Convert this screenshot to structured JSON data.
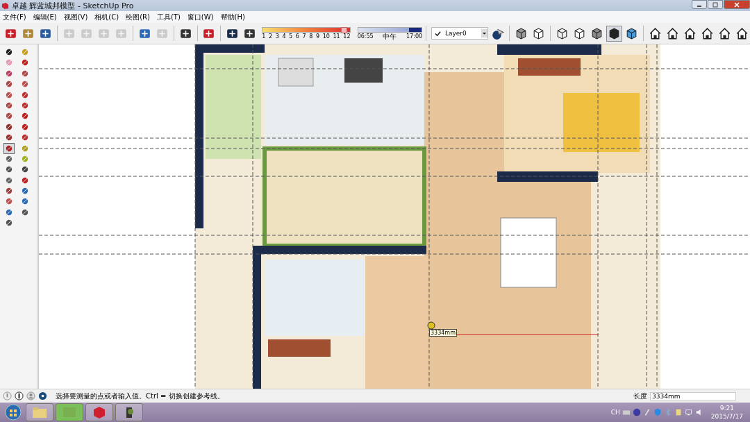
{
  "window": {
    "title": "卓越 辉蓝城邦模型 - SketchUp Pro"
  },
  "menu": [
    "文件(F)",
    "编辑(E)",
    "视图(V)",
    "相机(C)",
    "绘图(R)",
    "工具(T)",
    "窗口(W)",
    "帮助(H)"
  ],
  "toolbar": [
    {
      "disabled": false
    },
    {
      "disabled": false
    },
    {
      "disabled": false
    },
    {
      "disabled": true
    },
    {
      "disabled": true
    },
    {
      "disabled": true
    },
    {
      "disabled": true
    },
    {
      "disabled": false
    },
    {
      "disabled": true
    },
    {
      "disabled": false
    },
    {
      "disabled": false
    },
    {
      "disabled": false
    },
    {
      "disabled": false
    }
  ],
  "shadow_settings": {
    "date_slider": {
      "level": 0.93
    },
    "time_slider": {
      "level": 0.8
    },
    "months": [
      "1",
      "2",
      "3",
      "4",
      "5",
      "6",
      "7",
      "8",
      "9",
      "10",
      "11",
      "12"
    ],
    "time_start": "06:55",
    "time_middle": "中午",
    "time_end": "17:00"
  },
  "layer": {
    "value": "Layer0"
  },
  "view_tools": [
    {
      "selected": false
    },
    {
      "selected": false
    },
    {
      "selected": false
    },
    {
      "selected": false
    },
    {
      "selected": false
    },
    {
      "selected": true
    },
    {
      "selected": false
    }
  ],
  "camera_tools": [
    {
      "selected": false
    },
    {
      "selected": false
    },
    {
      "selected": false
    },
    {
      "selected": false
    },
    {
      "selected": false
    },
    {
      "selected": false
    }
  ],
  "left_tools": [
    {
      "selected": false
    },
    {
      "selected": false
    },
    {
      "selected": false
    },
    {
      "selected": false
    },
    {
      "selected": false
    },
    {
      "selected": false
    },
    {
      "selected": false
    },
    {
      "selected": false
    },
    {
      "selected": false
    },
    {
      "selected": false
    },
    {
      "selected": false
    },
    {
      "selected": false
    },
    {
      "selected": false
    },
    {
      "selected": false
    },
    {
      "selected": false
    },
    {
      "selected": false
    },
    {
      "selected": false
    },
    {
      "selected": false
    },
    {
      "selected": true
    },
    {
      "selected": false
    },
    {
      "selected": false
    },
    {
      "selected": false
    },
    {
      "selected": false
    },
    {
      "selected": false
    },
    {
      "selected": false
    },
    {
      "selected": false
    },
    {
      "selected": false
    },
    {
      "selected": false
    },
    {
      "selected": false
    },
    {
      "selected": false
    },
    {
      "selected": false
    },
    {
      "selected": false
    },
    {
      "selected": false
    }
  ],
  "canvas": {
    "measure_tooltip": "3334mm"
  },
  "status_bar": {
    "hint": "选择要测量的点或者输入值。Ctrl = 切换创建参考线。",
    "measurement_label": "长度",
    "measurement_value": "3334mm"
  },
  "taskbar": {
    "tray_language": "CH",
    "time": "9:21",
    "date": "2015/7/17"
  }
}
